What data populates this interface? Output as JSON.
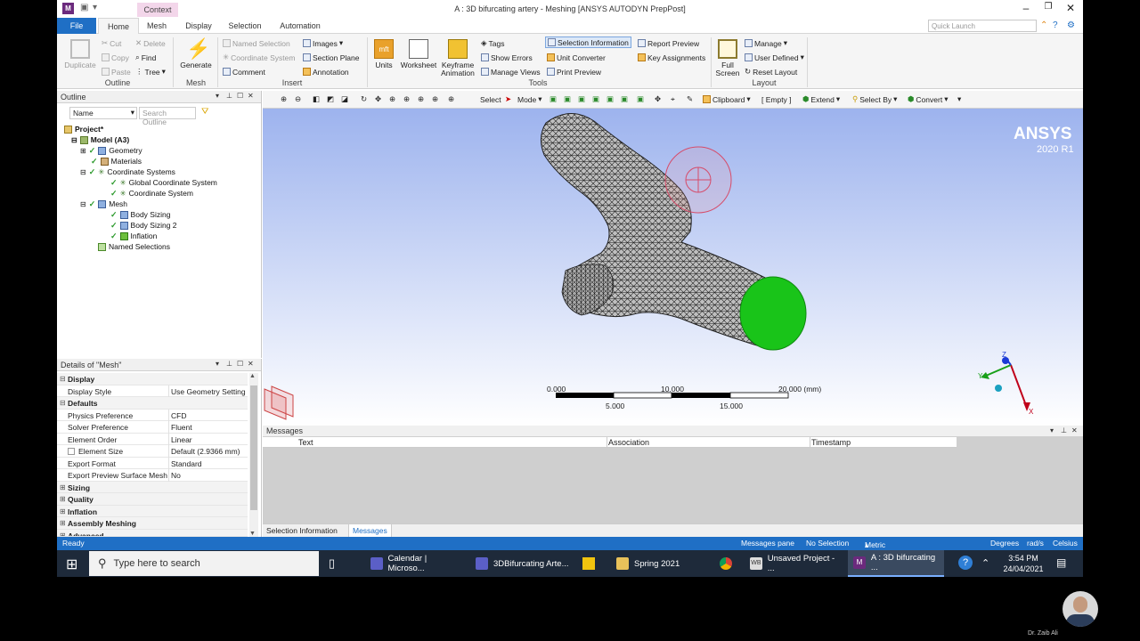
{
  "window": {
    "title": "A : 3D bifurcating artery - Meshing [ANSYS AUTODYN PrepPost]",
    "context_tab": "Context"
  },
  "tabs": [
    "File",
    "Home",
    "Mesh",
    "Display",
    "Selection",
    "Automation"
  ],
  "quick_launch_placeholder": "Quick Launch",
  "ribbon": {
    "outline": {
      "label": "Outline",
      "duplicate": "Duplicate",
      "cut": "Cut",
      "copy": "Copy",
      "paste": "Paste",
      "delete": "Delete",
      "find": "Find",
      "tree": "Tree"
    },
    "mesh": {
      "label": "Mesh",
      "generate": "Generate"
    },
    "insert": {
      "label": "Insert",
      "named_selection": "Named Selection",
      "coordinate_system": "Coordinate System",
      "comment": "Comment",
      "images": "Images",
      "section_plane": "Section Plane",
      "annotation": "Annotation"
    },
    "tools": {
      "label": "Tools",
      "units": "Units",
      "worksheet": "Worksheet",
      "keyframe": "Keyframe",
      "animation": "Animation",
      "tags": "Tags",
      "show_errors": "Show Errors",
      "manage_views": "Manage Views",
      "selection_information": "Selection Information",
      "unit_converter": "Unit Converter",
      "print_preview": "Print Preview",
      "report_preview": "Report Preview",
      "key_assignments": "Key Assignments"
    },
    "layout": {
      "label": "Layout",
      "full": "Full",
      "screen": "Screen",
      "manage": "Manage",
      "user_defined": "User Defined",
      "reset_layout": "Reset Layout"
    }
  },
  "outline": {
    "title": "Outline",
    "filter": "Name",
    "search_placeholder": "Search Outline",
    "tree": [
      {
        "label": "Project*"
      },
      {
        "label": "Model (A3)"
      },
      {
        "label": "Geometry"
      },
      {
        "label": "Materials"
      },
      {
        "label": "Coordinate Systems"
      },
      {
        "label": "Global Coordinate System"
      },
      {
        "label": "Coordinate System"
      },
      {
        "label": "Mesh"
      },
      {
        "label": "Body Sizing"
      },
      {
        "label": "Body Sizing 2"
      },
      {
        "label": "Inflation"
      },
      {
        "label": "Named Selections"
      }
    ]
  },
  "details": {
    "title": "Details of \"Mesh\"",
    "rows": [
      {
        "key": "Display",
        "value": "",
        "cat": true
      },
      {
        "key": "Display Style",
        "value": "Use Geometry Setting"
      },
      {
        "key": "Defaults",
        "value": "",
        "cat": true
      },
      {
        "key": "Physics Preference",
        "value": "CFD"
      },
      {
        "key": "Solver Preference",
        "value": "Fluent"
      },
      {
        "key": "Element Order",
        "value": "Linear"
      },
      {
        "key": "Element Size",
        "value": "Default (2.9366 mm)"
      },
      {
        "key": "Export Format",
        "value": "Standard"
      },
      {
        "key": "Export Preview Surface Mesh",
        "value": "No"
      },
      {
        "key": "Sizing",
        "value": "",
        "cat": true
      },
      {
        "key": "Quality",
        "value": "",
        "cat": true
      },
      {
        "key": "Inflation",
        "value": "",
        "cat": true
      },
      {
        "key": "Assembly Meshing",
        "value": "",
        "cat": true
      },
      {
        "key": "Advanced",
        "value": "",
        "cat": true
      }
    ]
  },
  "viewtools": {
    "select": "Select",
    "mode": "Mode",
    "clipboard": "Clipboard",
    "empty": "[ Empty ]",
    "extend": "Extend",
    "select_by": "Select By",
    "convert": "Convert"
  },
  "viewport": {
    "brand": "ANSYS",
    "version": "2020 R1",
    "scale": {
      "t0": "0.000",
      "t10": "10.000",
      "t20": "20.000 (mm)",
      "t5": "5.000",
      "t15": "15.000"
    },
    "triad": {
      "x": "X",
      "y": "Y",
      "z": "Z"
    }
  },
  "messages": {
    "title": "Messages",
    "columns": [
      "Text",
      "Association",
      "Timestamp"
    ],
    "tabs": [
      "Selection Information",
      "Messages"
    ]
  },
  "status": {
    "ready": "Ready",
    "messages_pane": "Messages pane",
    "selection": "No Selection",
    "units": "Metric (mm, kg, N, s, mV, mA)",
    "degrees": "Degrees",
    "rads": "rad/s",
    "temp": "Celsius"
  },
  "taskbar": {
    "search_placeholder": "Type here to search",
    "apps": [
      "Calendar | Microso...",
      "3DBifurcating Arte...",
      "Spring 2021",
      "Unsaved Project - ...",
      "A : 3D bifurcating ..."
    ],
    "time": "3:54 PM",
    "date": "24/04/2021"
  },
  "presenter": "Dr. Zaib Ali",
  "colors": {
    "accent": "#1f6fc5",
    "selected_face": "#19c419",
    "context_tab": "#f3d6ea"
  }
}
